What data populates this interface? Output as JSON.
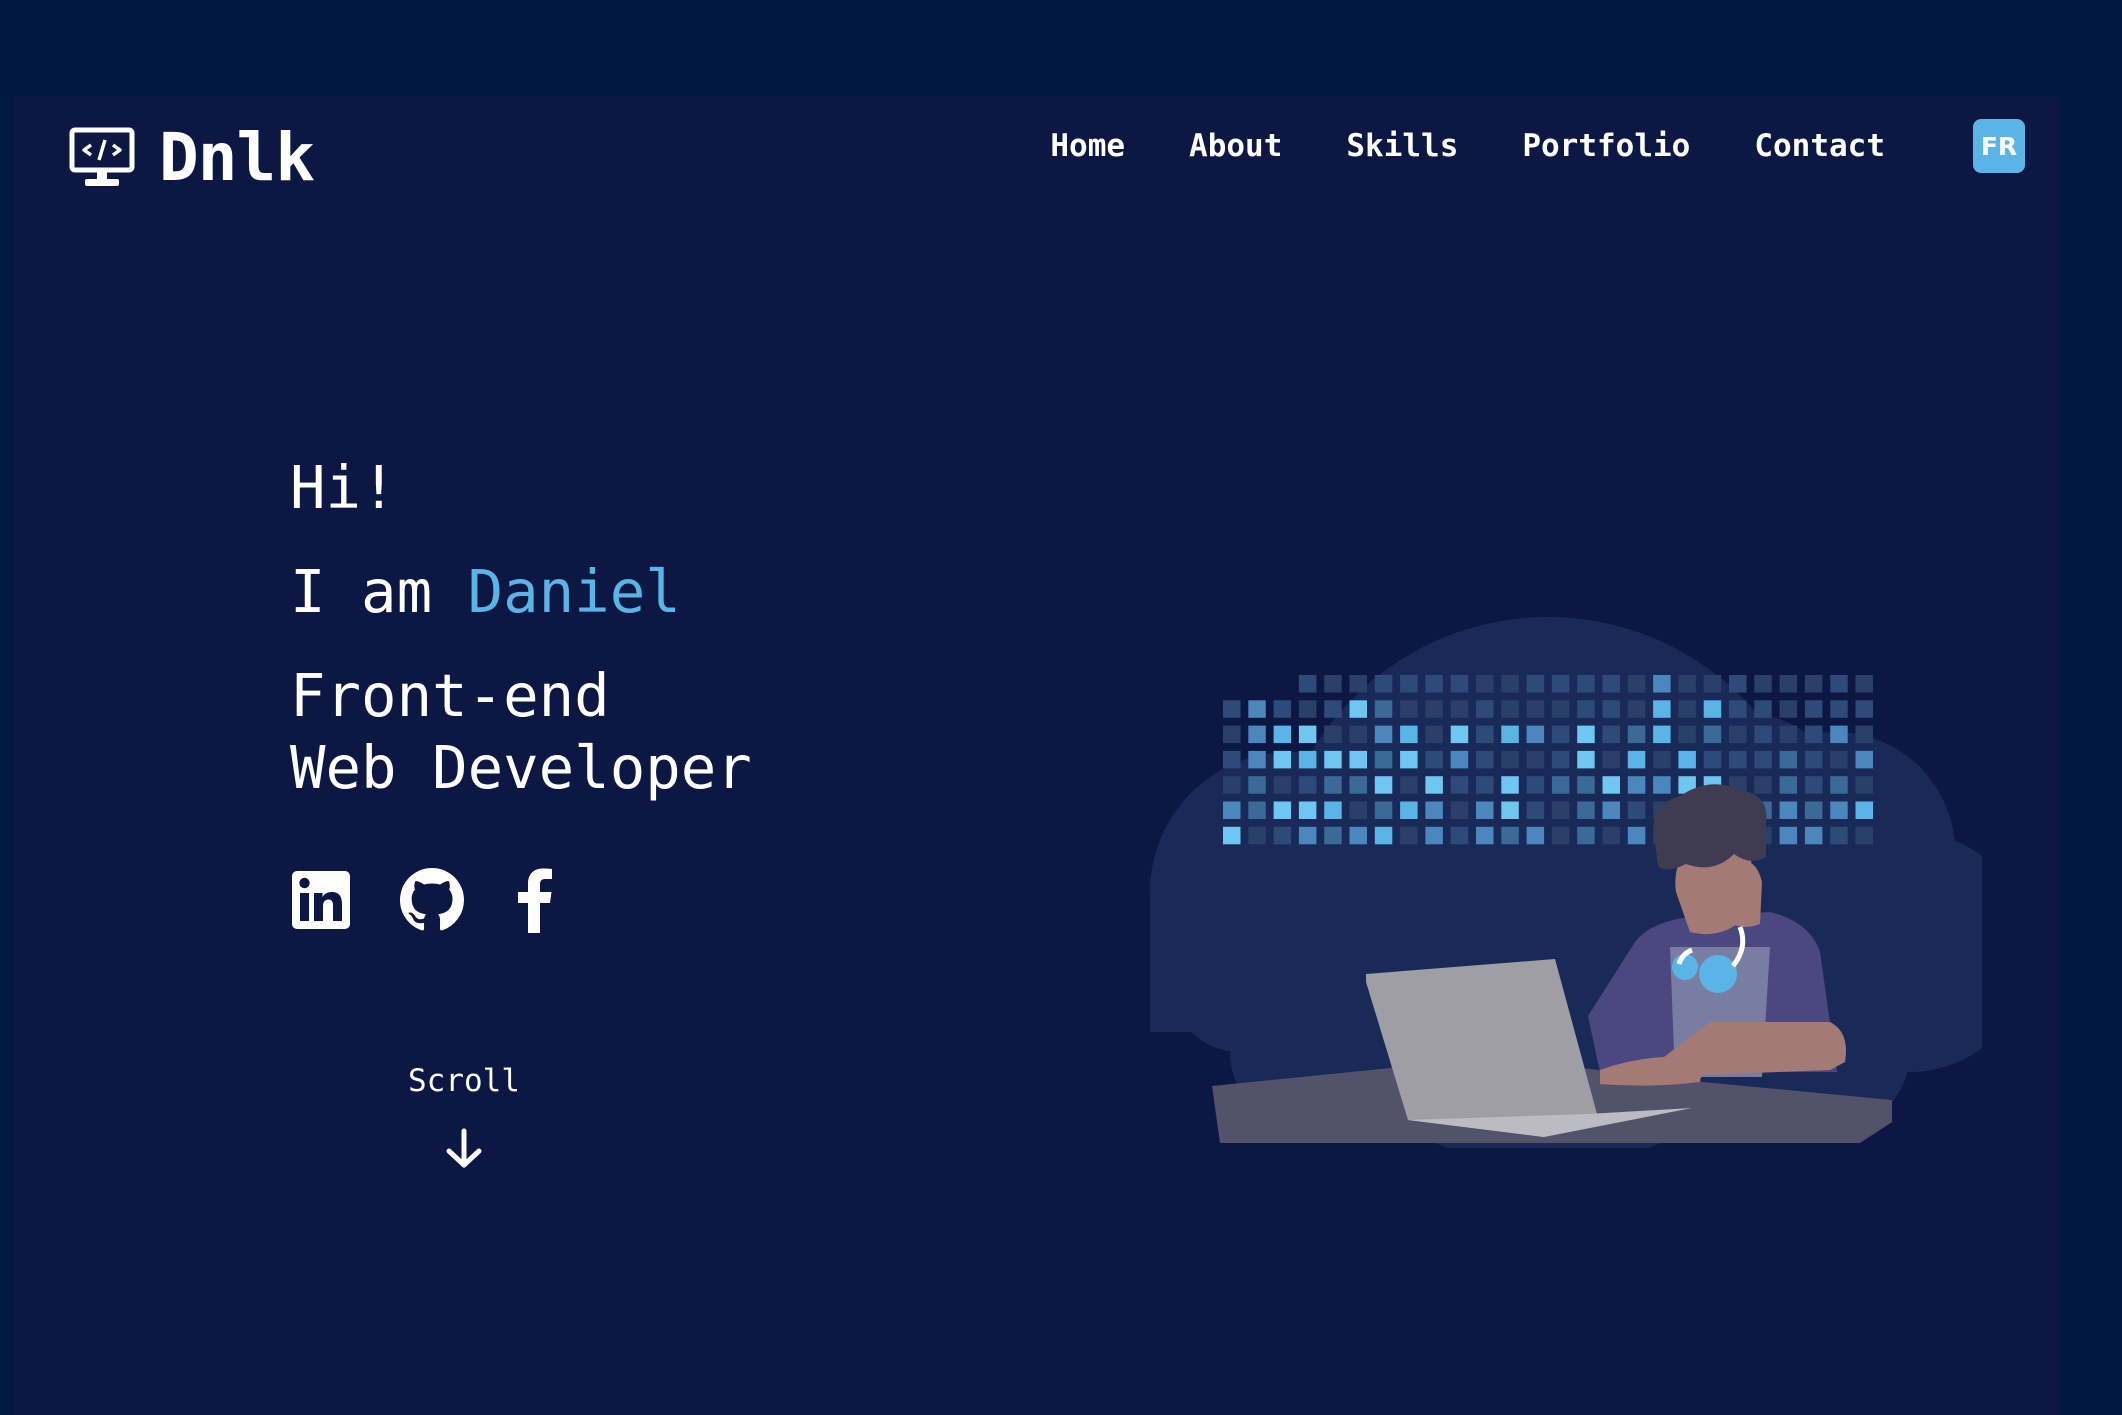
{
  "brand": {
    "name": "Dnlk",
    "icon": "monitor-code-icon"
  },
  "nav": {
    "items": [
      {
        "label": "Home"
      },
      {
        "label": "About"
      },
      {
        "label": "Skills"
      },
      {
        "label": "Portfolio"
      },
      {
        "label": "Contact"
      }
    ],
    "lang_toggle": "FR"
  },
  "hero": {
    "greeting": "Hi!",
    "intro_prefix": "I am ",
    "name": "Daniel",
    "role_line1": "Front-end",
    "role_line2": "Web Developer"
  },
  "social": [
    {
      "icon": "linkedin-icon"
    },
    {
      "icon": "github-icon"
    },
    {
      "icon": "facebook-icon"
    }
  ],
  "scroll": {
    "label": "Scroll",
    "icon": "arrow-down-icon"
  },
  "colors": {
    "page_bg": "#001842",
    "frame_bg": "#0c1843",
    "accent": "#5ab4e6",
    "text": "#ffffff"
  }
}
